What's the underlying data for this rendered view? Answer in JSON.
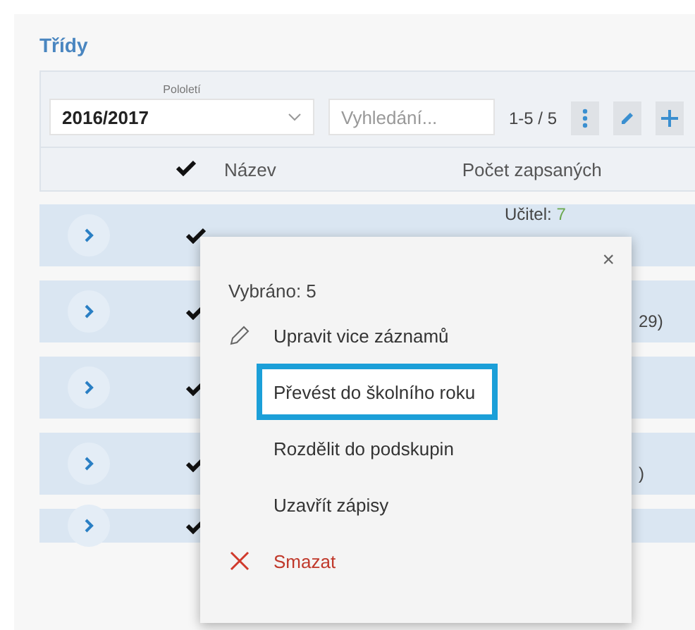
{
  "title": "Třídy",
  "filters": {
    "semester": {
      "label": "Pololetí",
      "value": "2016/2017"
    },
    "search": {
      "placeholder": "Vyhledání..."
    }
  },
  "paging": "1-5 / 5",
  "header_checked": true,
  "columns": [
    {
      "label": "Název"
    },
    {
      "label": "Počet zapsaných"
    }
  ],
  "rows": [
    {
      "checked": true,
      "label": "Učitel: ",
      "value": "7"
    },
    {
      "checked": true,
      "tail": "29)"
    },
    {
      "checked": true
    },
    {
      "checked": true,
      "tail": ")"
    },
    {
      "checked": true
    }
  ],
  "popup": {
    "close": "×",
    "selected_count": "Vybráno: 5",
    "items": [
      {
        "kind": "edit",
        "label": "Upravit vice záznamů",
        "selected": false
      },
      {
        "kind": "plain",
        "label": "Převést do školního roku",
        "selected": true
      },
      {
        "kind": "plain",
        "label": "Rozdělit do podskupin",
        "selected": false
      },
      {
        "kind": "plain",
        "label": "Uzavřít zápisy",
        "selected": false
      },
      {
        "kind": "delete",
        "label": "Smazat",
        "selected": false
      }
    ]
  }
}
